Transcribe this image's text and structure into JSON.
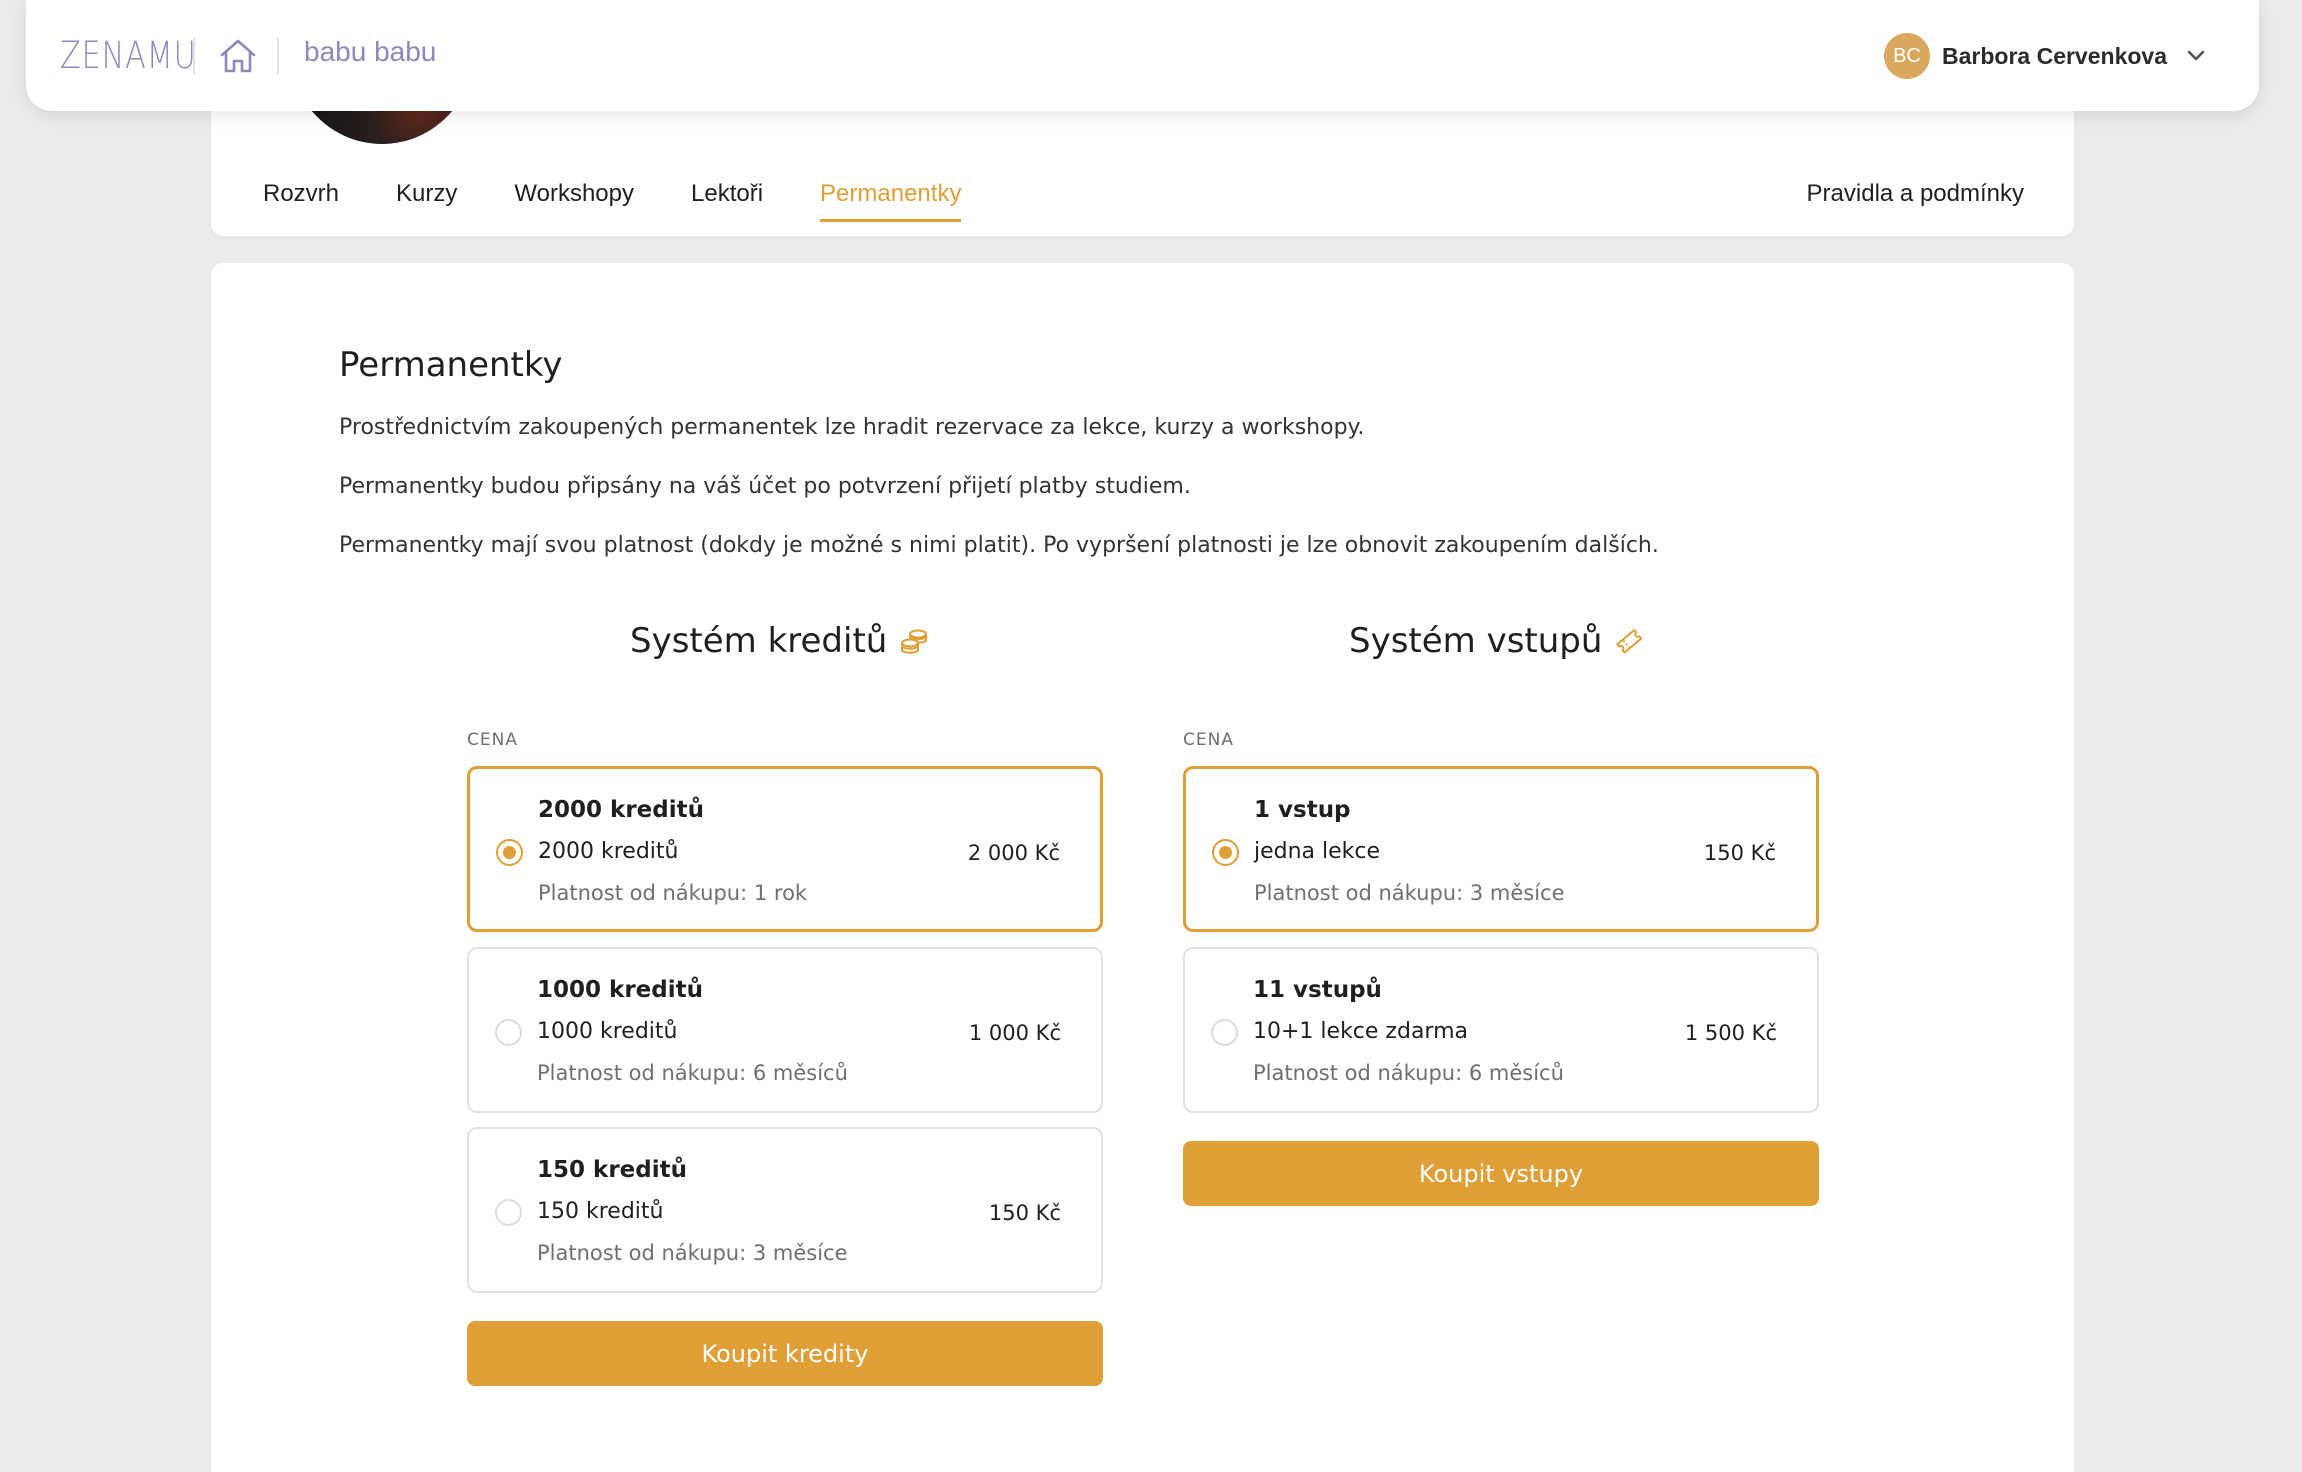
{
  "topbar": {
    "logo": "ZENAMU",
    "studio": "babu babu",
    "user": {
      "initials": "BC",
      "name": "Barbora Cervenkova"
    }
  },
  "nav": {
    "tabs": [
      "Rozvrh",
      "Kurzy",
      "Workshopy",
      "Lektoři",
      "Permanentky"
    ],
    "active": "Permanentky",
    "rules": "Pravidla a podmínky"
  },
  "main": {
    "title": "Permanentky",
    "paragraphs": [
      "Prostřednictvím zakoupených permanentek lze hradit rezervace za lekce, kurzy a workshopy.",
      "Permanentky budou připsány na váš účet po potvrzení přijetí platby studiem.",
      "Permanentky mají svou platnost (dokdy je možné s nimi platit). Po vypršení platnosti je lze obnovit zakoupením dalších."
    ]
  },
  "credits": {
    "title": "Systém kreditů",
    "icon": "coins-icon",
    "price_label": "CENA",
    "options": [
      {
        "name": "2000 kreditů",
        "desc": "2000 kreditů",
        "valid": "Platnost od nákupu: 1 rok",
        "price": "2 000 Kč",
        "selected": true
      },
      {
        "name": "1000 kreditů",
        "desc": "1000 kreditů",
        "valid": "Platnost od nákupu: 6 měsíců",
        "price": "1 000 Kč",
        "selected": false
      },
      {
        "name": "150 kreditů",
        "desc": "150 kreditů",
        "valid": "Platnost od nákupu: 3 měsíce",
        "price": "150 Kč",
        "selected": false
      }
    ],
    "button": "Koupit kredity"
  },
  "entries": {
    "title": "Systém vstupů",
    "icon": "ticket-icon",
    "price_label": "CENA",
    "options": [
      {
        "name": "1 vstup",
        "desc": "jedna lekce",
        "valid": "Platnost od nákupu: 3 měsíce",
        "price": "150 Kč",
        "selected": true
      },
      {
        "name": "11 vstupů",
        "desc": "10+1 lekce zdarma",
        "valid": "Platnost od nákupu: 6 měsíců",
        "price": "1 500 Kč",
        "selected": false
      }
    ],
    "button": "Koupit vstupy"
  },
  "colors": {
    "accent": "#e09e36",
    "brand": "#8b88bd"
  }
}
